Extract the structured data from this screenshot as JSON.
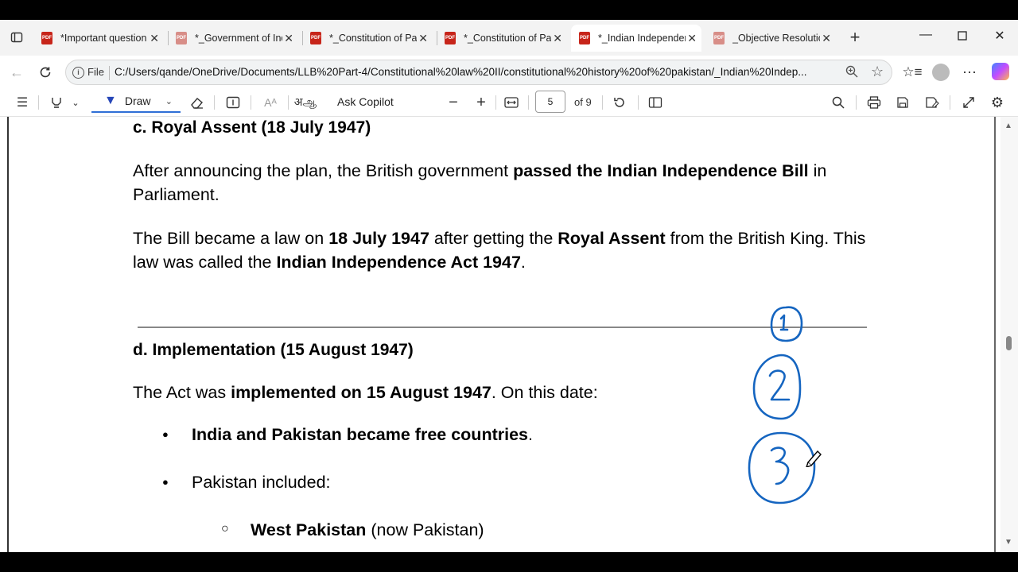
{
  "tabs": [
    {
      "title": "*Important question",
      "active": false
    },
    {
      "title": "*_Government of India",
      "active": false
    },
    {
      "title": "*_Constitution of Pakistan",
      "active": false
    },
    {
      "title": "*_Constitution of Pakistan",
      "active": false
    },
    {
      "title": "*_Indian Independence",
      "active": true
    },
    {
      "title": "_Objective Resolution",
      "active": false
    }
  ],
  "pdf_badge": "PDF",
  "address": {
    "scheme_label": "File",
    "url": "C:/Users/qande/OneDrive/Documents/LLB%20Part-4/Constitutional%20law%20II/constitutional%20history%20of%20pakistan/_Indian%20Indep..."
  },
  "toolbar": {
    "draw_label": "Draw",
    "read_aloud_label": "Aᴬ",
    "translate_label": "अஆ",
    "ask_copilot_label": "Ask Copilot",
    "page_number": "5",
    "page_total": "of 9"
  },
  "document": {
    "heading_c": "c. Royal Assent (18 July 1947)",
    "para1": [
      {
        "t": "After announcing the plan, the British government ",
        "b": false
      },
      {
        "t": "passed the Indian Independence Bill",
        "b": true
      },
      {
        "t": " in Parliament.",
        "b": false
      }
    ],
    "para2": [
      {
        "t": "The Bill became a law on ",
        "b": false
      },
      {
        "t": "18 July 1947",
        "b": true
      },
      {
        "t": " after getting the ",
        "b": false
      },
      {
        "t": "Royal Assent",
        "b": true
      },
      {
        "t": " from the British King. This law was called the ",
        "b": false
      },
      {
        "t": "Indian Independence Act 1947",
        "b": true
      },
      {
        "t": ".",
        "b": false
      }
    ],
    "heading_d": "d. Implementation (15 August 1947)",
    "para3": [
      {
        "t": "The Act was ",
        "b": false
      },
      {
        "t": "implemented on 15 August 1947",
        "b": true
      },
      {
        "t": ". On this date:",
        "b": false
      }
    ],
    "bullet1": [
      {
        "t": "India and Pakistan became free countries",
        "b": true
      },
      {
        "t": ".",
        "b": false
      }
    ],
    "bullet2": "Pakistan included:",
    "subbullet1": [
      {
        "t": "West Pakistan",
        "b": true
      },
      {
        "t": " (now Pakistan)",
        "b": false
      }
    ],
    "bullet_glyph": "●",
    "subbullet_glyph": "○"
  },
  "annotations": {
    "ink_color": "#1565c0",
    "circle_labels": [
      "1",
      "2",
      "3"
    ]
  },
  "colors": {
    "accent": "#2f6fd6",
    "pdf_icon": "#c7251a"
  }
}
